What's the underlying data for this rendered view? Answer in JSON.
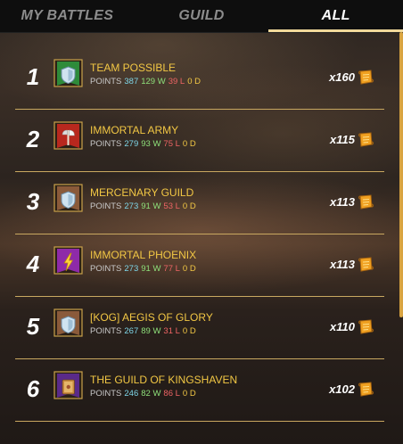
{
  "tabs": [
    {
      "label": "MY BATTLES",
      "active": false
    },
    {
      "label": "GUILD",
      "active": false
    },
    {
      "label": "ALL",
      "active": true
    }
  ],
  "stats_label": "POINTS",
  "rows": [
    {
      "rank": "1",
      "name": "TEAM POSSIBLE",
      "points": "387",
      "wins": "129 W",
      "losses": "39 L",
      "draws": "0 D",
      "reward": "x160",
      "badge": "shield",
      "banner_color": "#2e8b3a"
    },
    {
      "rank": "2",
      "name": "IMMORTAL ARMY",
      "points": "279",
      "wins": "93 W",
      "losses": "75 L",
      "draws": "0 D",
      "reward": "x115",
      "badge": "axe",
      "banner_color": "#b8281e"
    },
    {
      "rank": "3",
      "name": "MERCENARY GUILD",
      "points": "273",
      "wins": "91 W",
      "losses": "53 L",
      "draws": "0 D",
      "reward": "x113",
      "badge": "shield",
      "banner_color": "#8a5a3a"
    },
    {
      "rank": "4",
      "name": "IMMORTAL PHOENIX",
      "points": "273",
      "wins": "91 W",
      "losses": "77 L",
      "draws": "0 D",
      "reward": "x113",
      "badge": "lightning",
      "banner_color": "#8e2aa8"
    },
    {
      "rank": "5",
      "name": "[KOG] AEGIS OF GLORY",
      "points": "267",
      "wins": "89 W",
      "losses": "31 L",
      "draws": "0 D",
      "reward": "x110",
      "badge": "shield",
      "banner_color": "#8a5a3a"
    },
    {
      "rank": "6",
      "name": "THE GUILD OF KINGSHAVEN",
      "points": "246",
      "wins": "82 W",
      "losses": "86 L",
      "draws": "0 D",
      "reward": "x102",
      "badge": "book",
      "banner_color": "#5a2a8a"
    }
  ],
  "reward_icon": "merit-scroll-icon",
  "colors": {
    "accent": "#f2c744",
    "tab_underline": "#f0d89a",
    "points": "#7ed6e8",
    "wins": "#8ee07a",
    "losses": "#ee6464",
    "draws": "#f2c744"
  }
}
